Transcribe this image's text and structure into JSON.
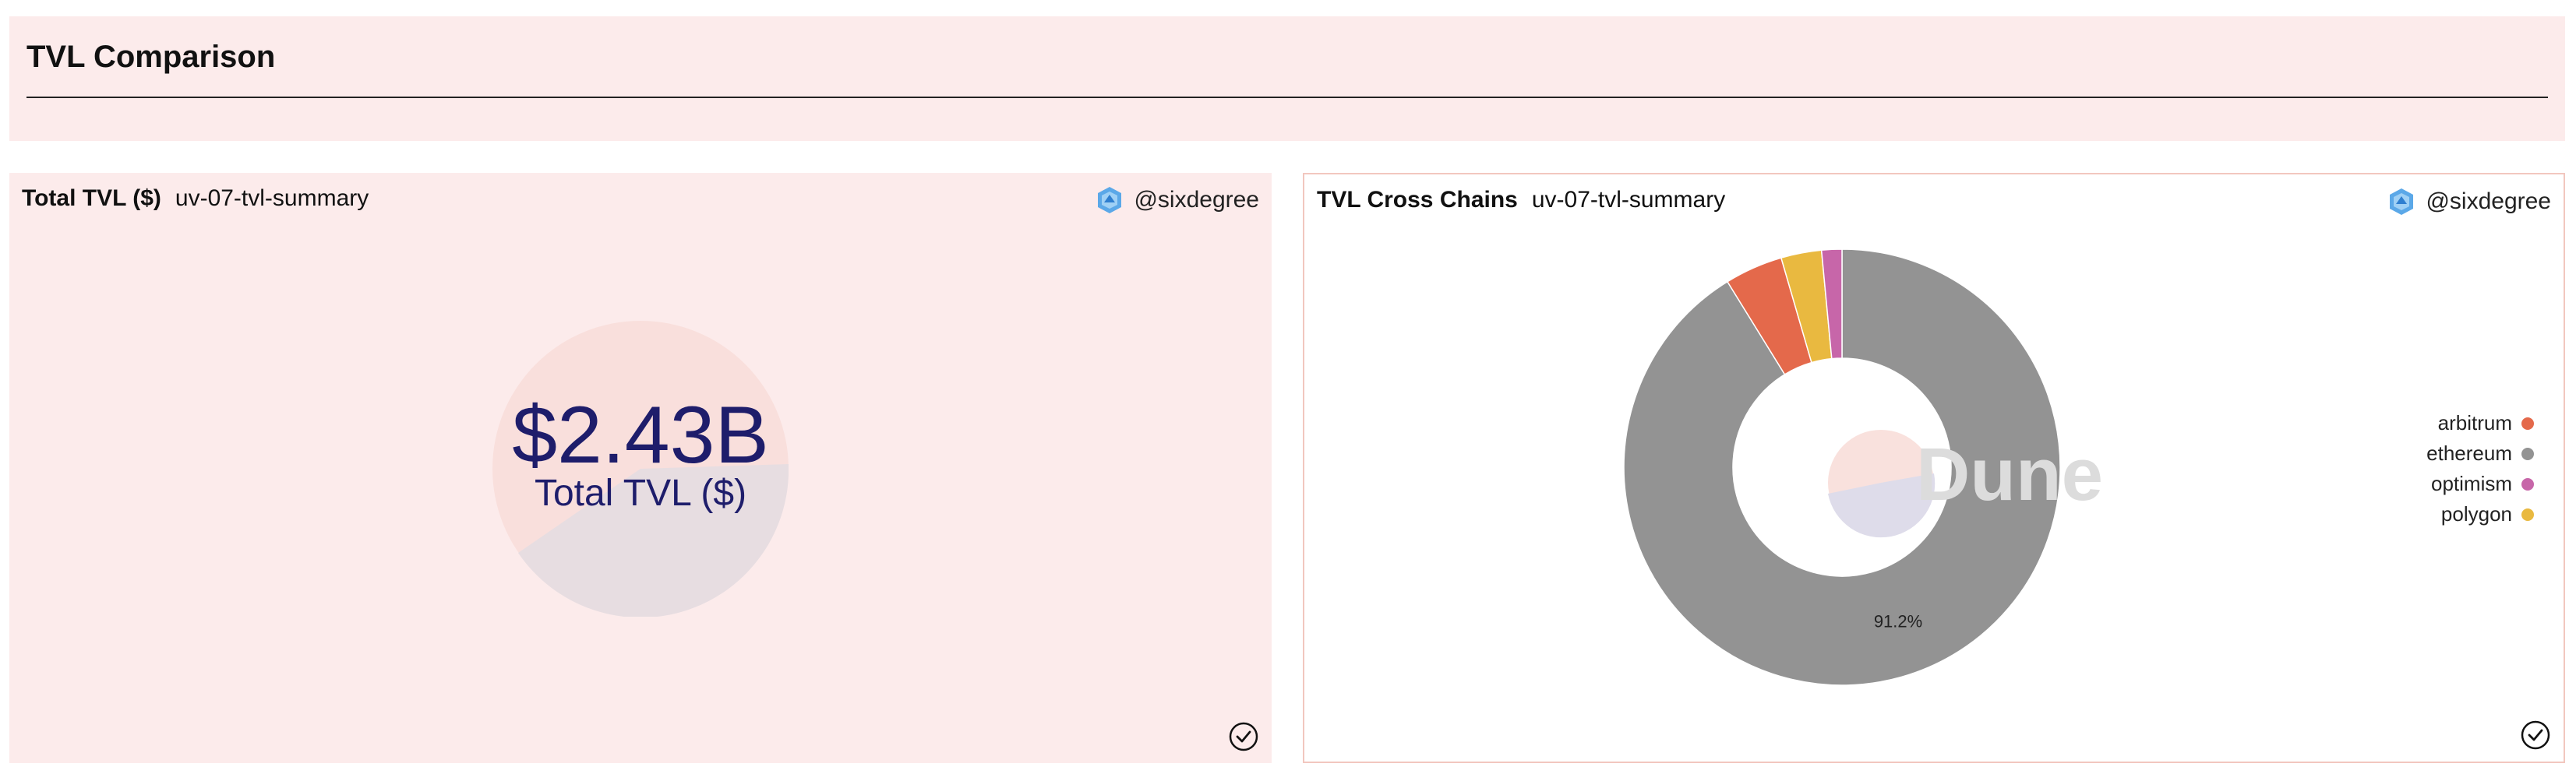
{
  "dashboard": {
    "title": "TVL Comparison"
  },
  "counter_card": {
    "name": "Total TVL ($)",
    "query": "uv-07-tvl-summary",
    "author": "@sixdegree",
    "value": "$2.43B",
    "label": "Total TVL ($)"
  },
  "pie_card": {
    "name": "TVL Cross Chains",
    "query": "uv-07-tvl-summary",
    "author": "@sixdegree",
    "watermark": "Dune"
  },
  "chart_data": {
    "type": "pie",
    "title": "TVL Cross Chains",
    "categories": [
      "ethereum",
      "arbitrum",
      "polygon",
      "optimism"
    ],
    "values": [
      91.2,
      4.3,
      3.0,
      1.5
    ],
    "colors": [
      "#939393",
      "#e4694b",
      "#e9b940",
      "#c766a9"
    ],
    "data_labels": [
      "91.2%",
      "",
      "",
      ""
    ],
    "legend": {
      "placement": "right",
      "entries": [
        {
          "label": "arbitrum",
          "color": "#e4694b"
        },
        {
          "label": "ethereum",
          "color": "#939393"
        },
        {
          "label": "optimism",
          "color": "#c766a9"
        },
        {
          "label": "polygon",
          "color": "#e9b940"
        }
      ]
    }
  }
}
